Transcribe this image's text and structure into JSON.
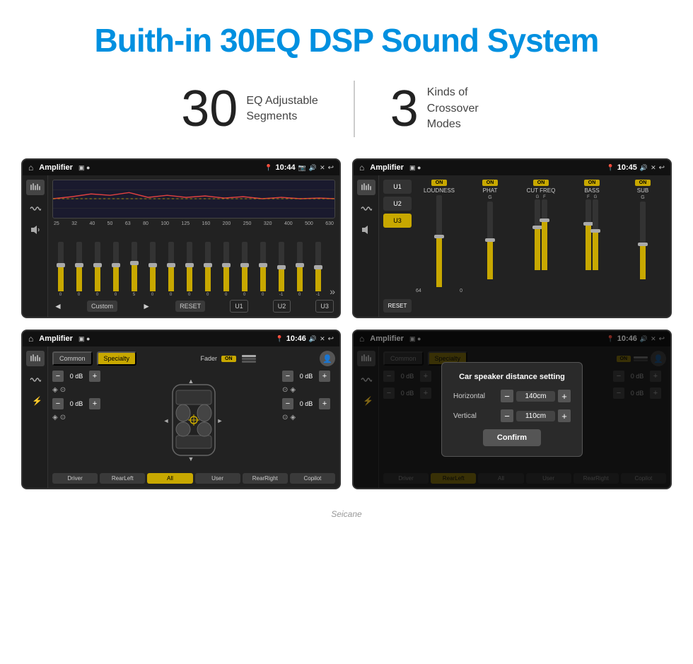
{
  "header": {
    "title": "Buith-in 30EQ DSP Sound System"
  },
  "stats": [
    {
      "number": "30",
      "label": "EQ Adjustable\nSegments"
    },
    {
      "number": "3",
      "label": "Kinds of\nCrossover Modes"
    }
  ],
  "screens": {
    "eq": {
      "title": "Amplifier",
      "time": "10:44",
      "frequencies": [
        "25",
        "32",
        "40",
        "50",
        "63",
        "80",
        "100",
        "125",
        "160",
        "200",
        "250",
        "320",
        "400",
        "500",
        "630"
      ],
      "values": [
        "0",
        "0",
        "0",
        "0",
        "5",
        "0",
        "0",
        "0",
        "0",
        "0",
        "0",
        "0",
        "-1",
        "0",
        "-1"
      ],
      "buttons": [
        "Custom",
        "RESET",
        "U1",
        "U2",
        "U3"
      ]
    },
    "crossover": {
      "title": "Amplifier",
      "time": "10:45",
      "presets": [
        "U1",
        "U2",
        "U3"
      ],
      "channels": [
        "LOUDNESS",
        "PHAT",
        "CUT FREQ",
        "BASS",
        "SUB"
      ],
      "reset_label": "RESET"
    },
    "speaker": {
      "title": "Amplifier",
      "time": "10:46",
      "tabs": [
        "Common",
        "Specialty"
      ],
      "fader_label": "Fader",
      "on_label": "ON",
      "db_values": [
        "0 dB",
        "0 dB",
        "0 dB",
        "0 dB"
      ],
      "position_btns": [
        "Driver",
        "RearLeft",
        "All",
        "User",
        "RearRight",
        "Copilot"
      ]
    },
    "dialog": {
      "title": "Amplifier",
      "time": "10:46",
      "dialog_title": "Car speaker distance setting",
      "horizontal_label": "Horizontal",
      "horizontal_value": "140cm",
      "vertical_label": "Vertical",
      "vertical_value": "110cm",
      "confirm_label": "Confirm",
      "tabs": [
        "Common",
        "Specialty"
      ],
      "db_values": [
        "0 dB",
        "0 dB"
      ],
      "position_btns": [
        "Driver",
        "RearLeft",
        "All",
        "User",
        "RearRight",
        "Copilot"
      ]
    }
  }
}
